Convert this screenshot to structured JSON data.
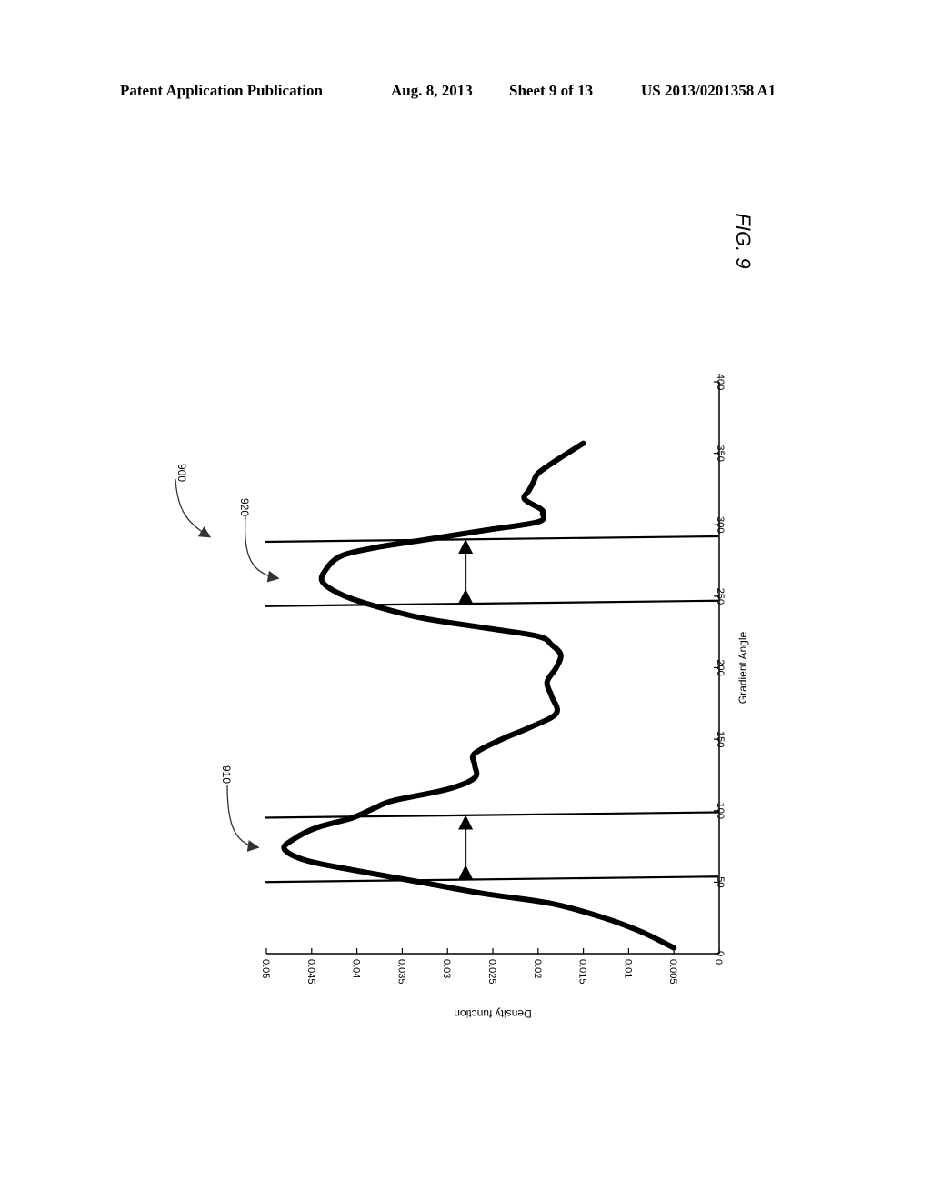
{
  "header": {
    "publication": "Patent Application Publication",
    "date": "Aug. 8, 2013",
    "sheet": "Sheet 9 of 13",
    "number": "US 2013/0201358 A1"
  },
  "figure": {
    "label": "FIG. 9",
    "orientation": "rotated 90 degrees clockwise",
    "ref_labels": {
      "figure": "900",
      "first_peak": "910",
      "second_peak": "920"
    }
  },
  "chart_data": {
    "type": "line",
    "title": "",
    "xlabel": "Gradient Angle",
    "ylabel": "Density function",
    "xlim": [
      0,
      400
    ],
    "ylim": [
      0,
      0.05
    ],
    "xticks": [
      "0",
      "50",
      "100",
      "150",
      "200",
      "250",
      "300",
      "350",
      "400"
    ],
    "yticks": [
      "0",
      "0.005",
      "0.01",
      "0.015",
      "0.02",
      "0.025",
      "0.03",
      "0.035",
      "0.04",
      "0.045",
      "0.05"
    ],
    "grid": false,
    "series": [
      {
        "name": "Density function",
        "x": [
          4,
          15,
          25,
          35,
          42,
          50,
          58,
          65,
          73,
          80,
          88,
          95,
          102,
          107,
          115,
          123,
          132,
          140,
          150,
          158,
          168,
          180,
          190,
          200,
          209,
          216,
          222,
          228,
          235,
          245,
          252,
          260,
          268,
          278,
          284,
          289,
          296,
          302,
          308,
          311,
          318,
          324,
          330,
          336,
          345,
          357
        ],
        "y": [
          0.005,
          0.0085,
          0.0127,
          0.0185,
          0.026,
          0.033,
          0.04,
          0.0455,
          0.048,
          0.047,
          0.0445,
          0.0405,
          0.038,
          0.036,
          0.03,
          0.027,
          0.027,
          0.027,
          0.024,
          0.021,
          0.018,
          0.0185,
          0.019,
          0.018,
          0.0175,
          0.0185,
          0.02,
          0.026,
          0.033,
          0.039,
          0.042,
          0.0438,
          0.0435,
          0.0418,
          0.038,
          0.033,
          0.026,
          0.02,
          0.0195,
          0.0197,
          0.0215,
          0.021,
          0.0205,
          0.02,
          0.018,
          0.015
        ]
      }
    ],
    "vertical_lines": [
      52,
      97,
      245,
      290
    ],
    "interval_arrows": [
      {
        "from": 52,
        "to": 97,
        "at_density": 0.028
      },
      {
        "from": 245,
        "to": 290,
        "at_density": 0.028
      }
    ]
  }
}
